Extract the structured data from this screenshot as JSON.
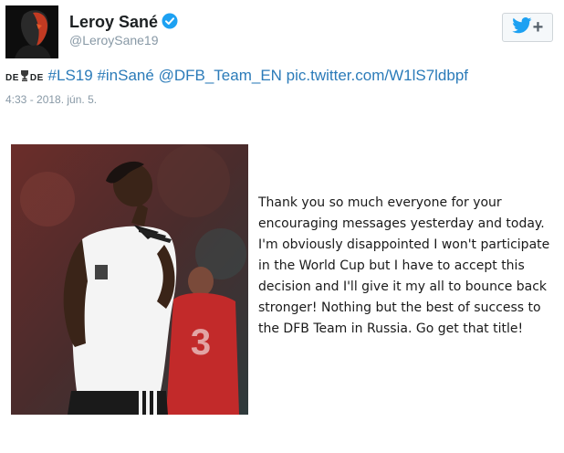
{
  "user": {
    "display_name": "Leroy Sané",
    "handle": "@LeroySane19"
  },
  "tweet": {
    "flag_left": "DE",
    "flag_right": "DE",
    "hashtag_1": "#LS19",
    "hashtag_2": "#inSané",
    "mention": "@DFB_Team_EN",
    "pic_link": "pic.twitter.com/W1lS7ldbpf",
    "timestamp": "4:33 - 2018. jún. 5."
  },
  "statement": {
    "text": "Thank you so much everyone for your encouraging messages yesterday and today. I'm obviously disappointed I won't participate in the World Cup but I have to accept this decision and I'll give it my all to bounce back stronger! Nothing but the best of success to the DFB Team in Russia. Go get that title!"
  },
  "icons": {
    "verified": "verified-badge-icon",
    "follow": "twitter-bird-icon",
    "trophy": "trophy-icon"
  },
  "colors": {
    "link": "#2b7bb9",
    "verified": "#1da1f2",
    "twitter_bird": "#1da1f2",
    "handle": "#8899a6"
  }
}
